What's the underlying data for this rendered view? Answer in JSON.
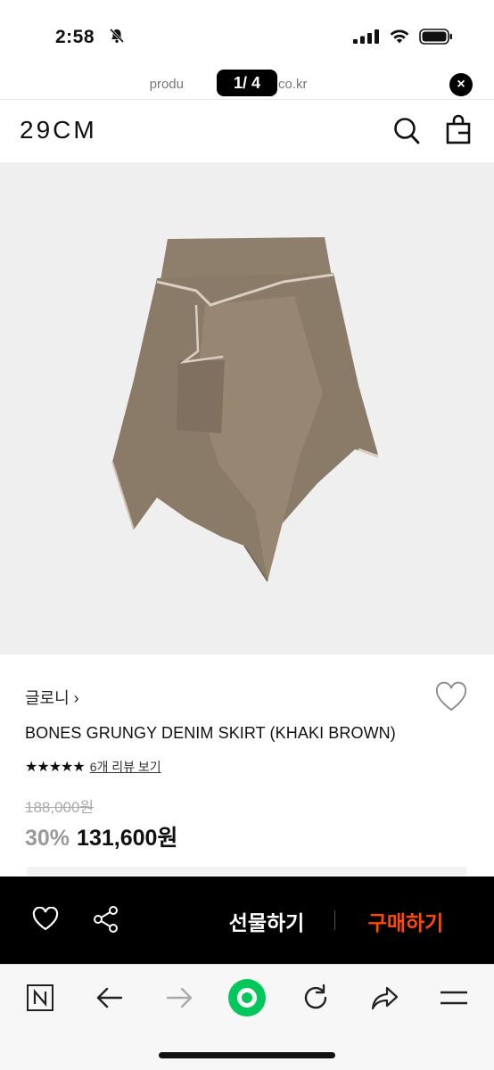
{
  "status_bar": {
    "time": "2:58",
    "icons": [
      "bell-slash-icon",
      "signal-icon",
      "wifi-icon",
      "battery-icon"
    ]
  },
  "url_bar": {
    "url_left": "produ",
    "url_right": "co.kr",
    "page_counter": "1/ 4",
    "close_symbol": "×"
  },
  "header": {
    "brand_logo": "29CM",
    "icons": [
      "search-icon",
      "shopping-bag-icon"
    ]
  },
  "product": {
    "brand": "글로니 ›",
    "name": "BONES GRUNGY DENIM SKIRT (KHAKI BROWN)",
    "rating_stars": "★★★★★",
    "rating": 5,
    "review_link": "6개 리뷰 보기",
    "original_price": "188,000원",
    "discount_rate": "30%",
    "sale_price": "131,600원"
  },
  "action_bar": {
    "gift_label": "선물하기",
    "buy_label": "구매하기",
    "icons": [
      "heart-icon",
      "share-icon"
    ]
  },
  "browser_toolbar": {
    "icons": [
      "naver-n-icon",
      "back-arrow-icon",
      "forward-arrow-icon",
      "home-circle-icon",
      "reload-icon",
      "share-arrow-icon",
      "menu-icon"
    ]
  },
  "colors": {
    "buy_accent": "#ff4800",
    "action_bar_bg": "#000000",
    "image_bg": "#efefef",
    "home_circle": "#03c75a"
  }
}
